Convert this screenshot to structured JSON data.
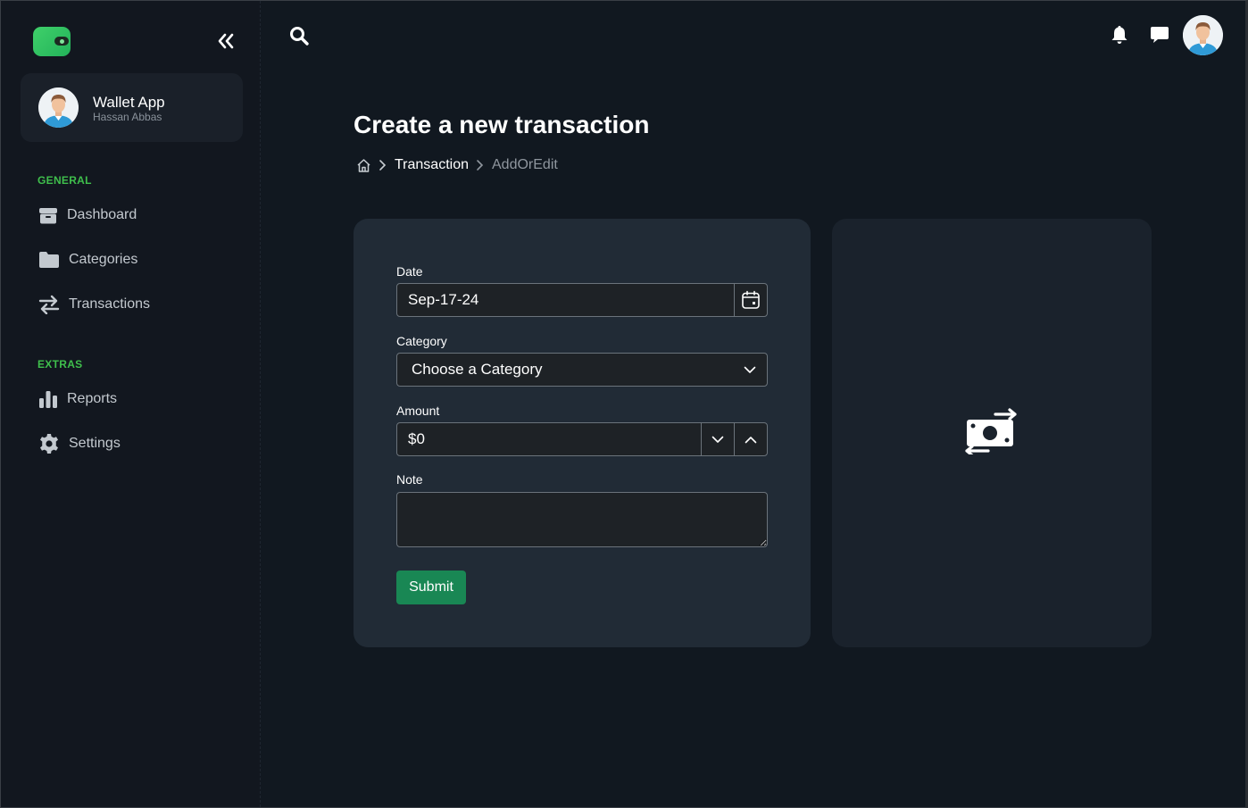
{
  "app": {
    "name": "Wallet App",
    "user": "Hassan Abbas"
  },
  "sidebar": {
    "sections": [
      {
        "title": "GENERAL",
        "items": [
          {
            "label": "Dashboard",
            "icon": "box-icon"
          },
          {
            "label": "Categories",
            "icon": "folder-icon"
          },
          {
            "label": "Transactions",
            "icon": "arrows-exchange-icon"
          }
        ]
      },
      {
        "title": "EXTRAS",
        "items": [
          {
            "label": "Reports",
            "icon": "bar-chart-icon"
          },
          {
            "label": "Settings",
            "icon": "gear-icon"
          }
        ]
      }
    ]
  },
  "header": {
    "icons": [
      "search-icon",
      "bell-icon",
      "chat-icon",
      "avatar"
    ]
  },
  "page": {
    "title": "Create a new transaction",
    "breadcrumb": {
      "link": "Transaction",
      "current": "AddOrEdit"
    }
  },
  "form": {
    "date_label": "Date",
    "date_value": "Sep-17-24",
    "category_label": "Category",
    "category_value": "Choose a Category",
    "amount_label": "Amount",
    "amount_value": "$0",
    "note_label": "Note",
    "note_value": "",
    "submit_label": "Submit"
  },
  "colors": {
    "accent_green": "#3fbf4c",
    "submit_green": "#198754",
    "background": "#111820",
    "card": "#212b36"
  }
}
